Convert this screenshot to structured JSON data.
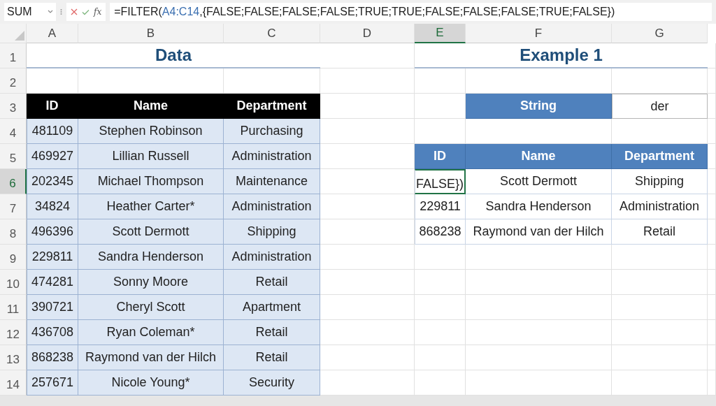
{
  "formula_bar": {
    "name_box": "SUM",
    "function_label": "fx",
    "formula": [
      {
        "kind": "text",
        "text": "=FILTER("
      },
      {
        "kind": "reference",
        "text": "A4:C14"
      },
      {
        "kind": "text",
        "text": ",{FALSE;FALSE;FALSE;FALSE;TRUE;TRUE;FALSE;FALSE;FALSE;TRUE;FALSE})"
      }
    ]
  },
  "column_headers": [
    {
      "label": "A",
      "selected": false
    },
    {
      "label": "B",
      "selected": false
    },
    {
      "label": "C",
      "selected": false
    },
    {
      "label": "D",
      "selected": false
    },
    {
      "label": "E",
      "selected": true
    },
    {
      "label": "F",
      "selected": false
    },
    {
      "label": "G",
      "selected": false
    }
  ],
  "row_headers": [
    {
      "label": "1",
      "selected": false
    },
    {
      "label": "2",
      "selected": false
    },
    {
      "label": "3",
      "selected": false
    },
    {
      "label": "4",
      "selected": false
    },
    {
      "label": "5",
      "selected": false
    },
    {
      "label": "6",
      "selected": true
    },
    {
      "label": "7",
      "selected": false
    },
    {
      "label": "8",
      "selected": false
    },
    {
      "label": "9",
      "selected": false
    },
    {
      "label": "10",
      "selected": false
    },
    {
      "label": "11",
      "selected": false
    },
    {
      "label": "12",
      "selected": false
    },
    {
      "label": "13",
      "selected": false
    },
    {
      "label": "14",
      "selected": false
    }
  ],
  "data_table": {
    "title": "Data",
    "columns": [
      "ID",
      "Name",
      "Department"
    ],
    "rows": [
      [
        "481109",
        "Stephen Robinson",
        "Purchasing"
      ],
      [
        "469927",
        "Lillian Russell",
        "Administration"
      ],
      [
        "202345",
        "Michael Thompson",
        "Maintenance"
      ],
      [
        "34824",
        "Heather Carter*",
        "Administration"
      ],
      [
        "496396",
        "Scott Dermott",
        "Shipping"
      ],
      [
        "229811",
        "Sandra Henderson",
        "Administration"
      ],
      [
        "474281",
        "Sonny Moore",
        "Retail"
      ],
      [
        "390721",
        "Cheryl Scott",
        "Apartment"
      ],
      [
        "436708",
        "Ryan Coleman*",
        "Retail"
      ],
      [
        "868238",
        "Raymond van der Hilch",
        "Retail"
      ],
      [
        "257671",
        "Nicole Young*",
        "Security"
      ]
    ]
  },
  "example": {
    "title": "Example 1",
    "criteria_label": "String",
    "criteria_value": "der",
    "columns": [
      "ID",
      "Name",
      "Department"
    ],
    "rows": [
      {
        "cells": [
          "FALSE})",
          "Scott Dermott",
          "Shipping"
        ],
        "active_cell": true
      },
      {
        "cells": [
          "229811",
          "Sandra Henderson",
          "Administration"
        ],
        "active_cell": false
      },
      {
        "cells": [
          "868238",
          "Raymond van der Hilch",
          "Retail"
        ],
        "active_cell": false
      }
    ]
  }
}
